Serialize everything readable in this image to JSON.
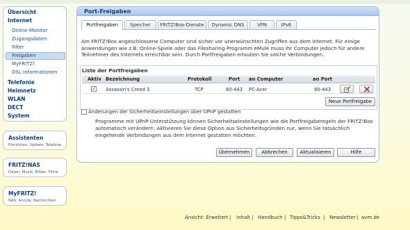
{
  "nav": {
    "main_items": [
      "Übersicht",
      "Internet",
      "Telefonie",
      "Heimnetz",
      "WLAN",
      "DECT",
      "System"
    ],
    "internet_sub": [
      "Online-Monitor",
      "Zugangsdaten",
      "Filter",
      "Freigaben",
      "MyFRITZ!",
      "DSL-Informationen"
    ],
    "selected_sub": "Freigaben"
  },
  "boxes": {
    "assistenten": {
      "title": "Assistenten",
      "sub": "Einrichten, Update, Telefone"
    },
    "nas": {
      "title": "FRITZ!NAS",
      "sub": "Daten, Musik, Bilder, Filme"
    },
    "myfritz": {
      "title": "MyFRITZ!",
      "sub": "NAS, Anrufe, Nachrichten"
    }
  },
  "panel": {
    "title": "Port-Freigaben",
    "tabs": [
      "Portfreigaben",
      "Speicher",
      "FRITZ!Box-Dienste",
      "Dynamic DNS",
      "VPN",
      "IPv6"
    ],
    "active_tab": "Portfreigaben",
    "intro": "Am FRITZ!Box angeschlossene Computer sind sicher vor unerwünschten Zugriffen aus dem Internet. Für einige Anwendungen wie z.B. Online-Spiele oder das Filesharing-Programm eMule muss Ihr Computer jedoch für andere Teilnehmer des Internets erreichbar sein. Durch Portfreigaben erlauben Sie solche Verbindungen.",
    "list_title": "Liste der Portfreigaben",
    "columns": [
      "Aktiv",
      "Bezeichnung",
      "Protokoll",
      "Port",
      "an Computer",
      "an Port"
    ],
    "rows": [
      {
        "active": true,
        "name": "Assassin's Creed 3",
        "protocol": "TCP",
        "port": "80-443",
        "computer": "PC-Acer",
        "to_port": "80-443"
      }
    ],
    "new_button": "Neue Portfreigabe",
    "upnp_label": "Änderungen der Sicherheitseinstellungen über UPnP gestatten",
    "upnp_checked": false,
    "upnp_text": "Programme mit UPnP-Unterstützung können Sicherheitseinstellungen wie die Portfreigaberegeln der FRITZ!Box automatisch verändern. Aktivieren Sie diese Option aus Sicherheitsgründen nur, wenn Sie tatsächlich eingehende Verbindungen aus dem Internet gestatten möchten.",
    "buttons": {
      "apply": "Übernehmen",
      "cancel": "Abbrechen",
      "refresh": "Aktualisieren",
      "help": "Hilfe"
    }
  },
  "footer": {
    "view": "Ansicht: Erweitert",
    "links": [
      "Inhalt",
      "Handbuch",
      "Tipps&Tricks",
      "Newsletter",
      "avm.de"
    ]
  },
  "colors": {
    "nav_text": "#0d3d84",
    "panel_head": "#a9c6ea",
    "delete_icon": "#c0392b",
    "selected": "#c9dcf2"
  }
}
